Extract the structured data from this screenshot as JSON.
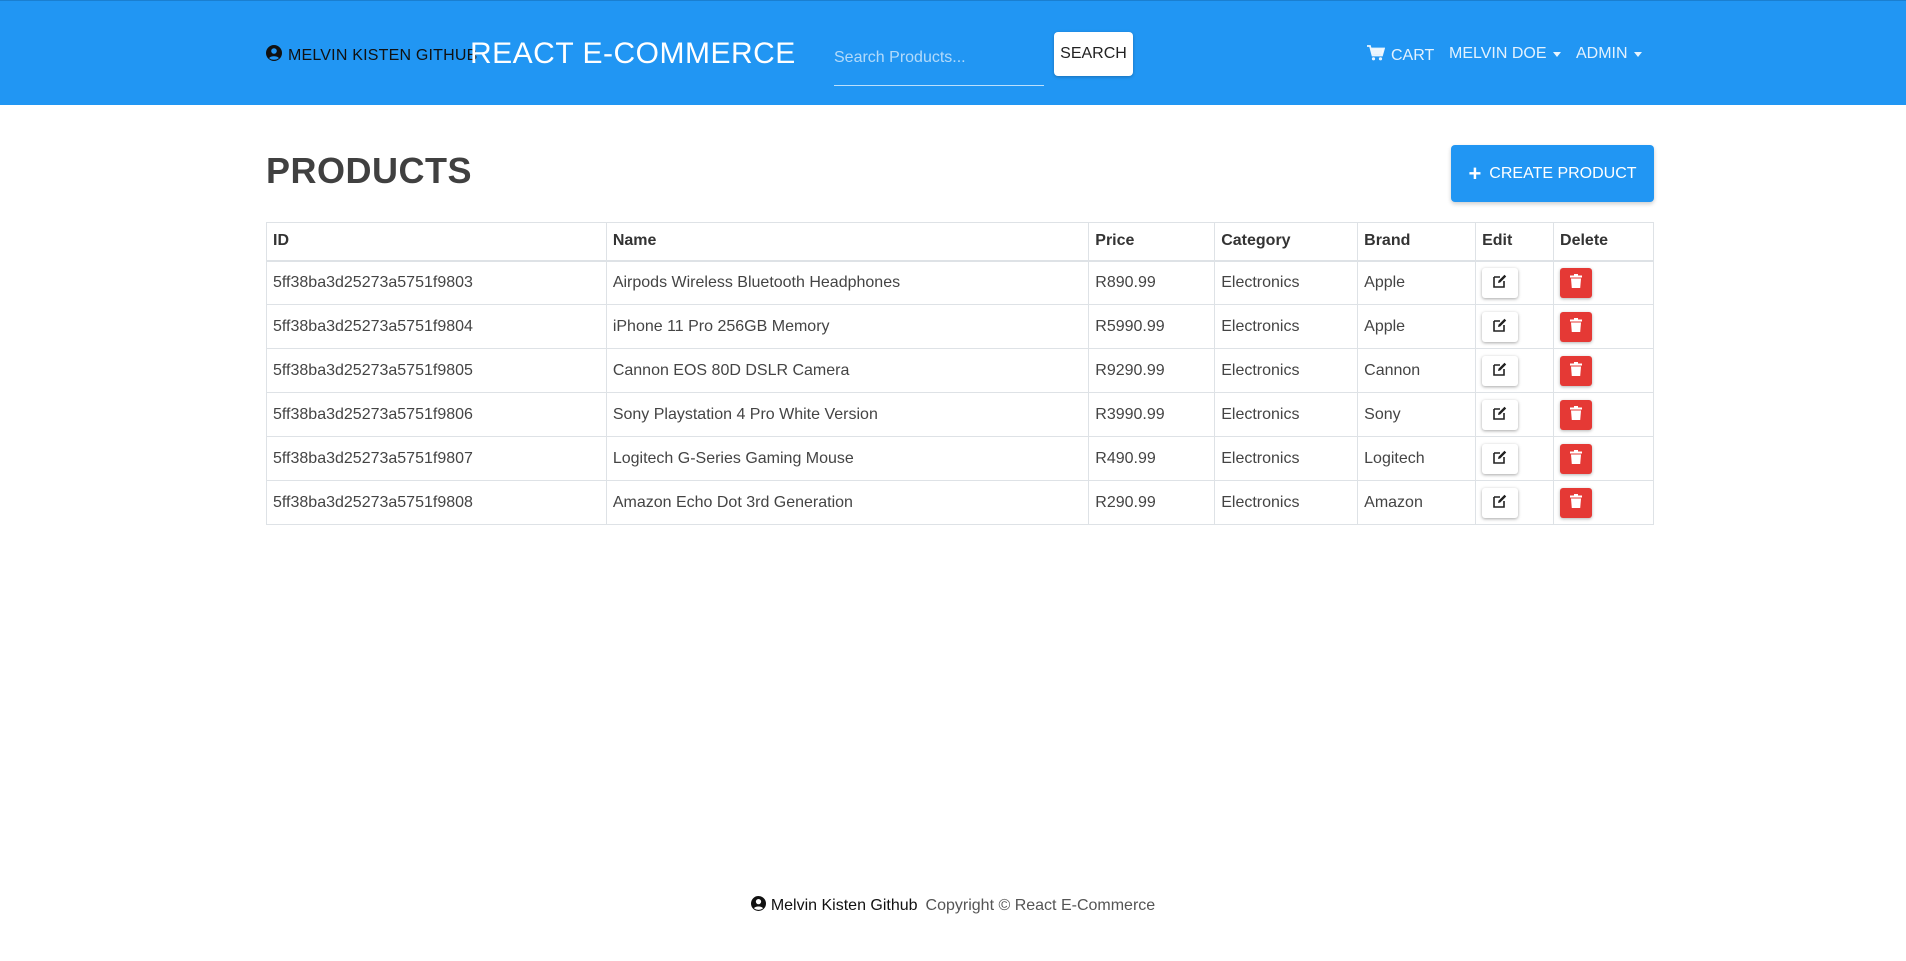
{
  "navbar": {
    "github_link": "MELVIN KISTEN GITHUB",
    "brand": "REACT E-COMMERCE",
    "search_placeholder": "Search Products...",
    "search_button": "SEARCH",
    "cart": "CART",
    "user_menu": "MELVIN DOE",
    "admin_menu": "ADMIN"
  },
  "main": {
    "title": "PRODUCTS",
    "create_button": "CREATE PRODUCT"
  },
  "table": {
    "headers": [
      "ID",
      "Name",
      "Price",
      "Category",
      "Brand",
      "Edit",
      "Delete"
    ],
    "rows": [
      {
        "id": "5ff38ba3d25273a5751f9803",
        "name": "Airpods Wireless Bluetooth Headphones",
        "price": "R890.99",
        "category": "Electronics",
        "brand": "Apple"
      },
      {
        "id": "5ff38ba3d25273a5751f9804",
        "name": "iPhone 11 Pro 256GB Memory",
        "price": "R5990.99",
        "category": "Electronics",
        "brand": "Apple"
      },
      {
        "id": "5ff38ba3d25273a5751f9805",
        "name": "Cannon EOS 80D DSLR Camera",
        "price": "R9290.99",
        "category": "Electronics",
        "brand": "Cannon"
      },
      {
        "id": "5ff38ba3d25273a5751f9806",
        "name": "Sony Playstation 4 Pro White Version",
        "price": "R3990.99",
        "category": "Electronics",
        "brand": "Sony"
      },
      {
        "id": "5ff38ba3d25273a5751f9807",
        "name": "Logitech G-Series Gaming Mouse",
        "price": "R490.99",
        "category": "Electronics",
        "brand": "Logitech"
      },
      {
        "id": "5ff38ba3d25273a5751f9808",
        "name": "Amazon Echo Dot 3rd Generation",
        "price": "R290.99",
        "category": "Electronics",
        "brand": "Amazon"
      }
    ]
  },
  "footer": {
    "github_link": "Melvin Kisten Github",
    "copyright": "Copyright © React E-Commerce"
  },
  "icons": {
    "github": "user-circle-icon",
    "cart": "shopping-cart-icon",
    "plus": "plus-icon",
    "edit": "edit-icon",
    "delete": "trash-icon"
  },
  "colors": {
    "primary": "#2196f3",
    "danger": "#e53935"
  }
}
